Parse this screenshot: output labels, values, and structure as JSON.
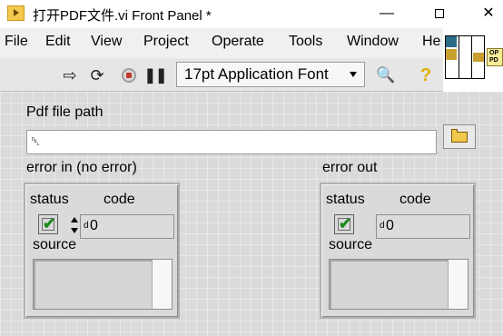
{
  "window": {
    "title": "打开PDF文件.vi Front Panel *",
    "minimize_glyph": "—",
    "close_glyph": "✕"
  },
  "menu": {
    "items": [
      "File",
      "Edit",
      "View",
      "Project",
      "Operate",
      "Tools",
      "Window",
      "He"
    ]
  },
  "toolbar": {
    "font_select_value": "17pt Application Font",
    "icons": [
      "run-arrow-icon",
      "run-continuously-icon",
      "abort-icon",
      "pause-icon",
      "search-icon",
      "help-icon"
    ],
    "run_glyph": "⇨",
    "run_cont_glyph": "⟳",
    "pause_glyph": "❚❚",
    "search_glyph": "🔍",
    "help_glyph": "?"
  },
  "vi_icon": {
    "label": "OP\nPD"
  },
  "front_panel": {
    "path_control": {
      "label": "Pdf file path",
      "value": "",
      "glyph": "␡"
    },
    "error_in": {
      "label": "error in (no error)",
      "status_label": "status",
      "code_label": "code",
      "source_label": "source",
      "status_value": "✔",
      "radix": "d",
      "code_value": "0",
      "source_value": ""
    },
    "error_out": {
      "label": "error out",
      "status_label": "status",
      "code_label": "code",
      "source_label": "source",
      "status_value": "✔",
      "radix": "d",
      "code_value": "0",
      "source_value": ""
    }
  },
  "colors": {
    "panel_bg": "#dadada",
    "menu_bg": "#f0f0f0",
    "toolbar_bg": "#e6e6e6",
    "check_green": "#1a8a1a"
  }
}
